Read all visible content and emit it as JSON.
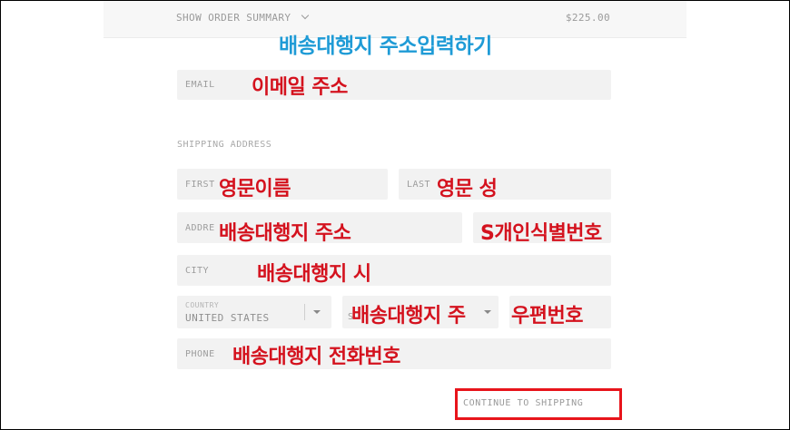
{
  "header": {
    "summary_label": "SHOW ORDER SUMMARY",
    "total": "$225.00"
  },
  "annotations": {
    "title": "배송대행지 주소입력하기",
    "email": "이메일 주소",
    "first_name": "영문이름",
    "last_name": "영문 성",
    "address": "배송대행지 주소",
    "suite": "S개인식별번호",
    "city": "배송대행지 시",
    "state": "배송대행지 주",
    "zip": "우편번호",
    "phone": "배송대행지 전화번호"
  },
  "form": {
    "email_placeholder": "EMAIL",
    "section_label": "SHIPPING ADDRESS",
    "first_placeholder": "FIRST",
    "last_placeholder": "LAST",
    "address_placeholder": "ADDRE",
    "city_placeholder": "CITY",
    "country_label": "COUNTRY",
    "country_value": "UNITED STATES",
    "state_placeholder": "S",
    "phone_placeholder": "PHONE",
    "continue_label": "CONTINUE TO SHIPPING"
  },
  "colors": {
    "annotation": "#d4121e",
    "title": "#1f9bd6",
    "highlight_box": "#e8141b"
  },
  "icons": [
    "chevron-down-icon",
    "select-arrow-icon"
  ]
}
